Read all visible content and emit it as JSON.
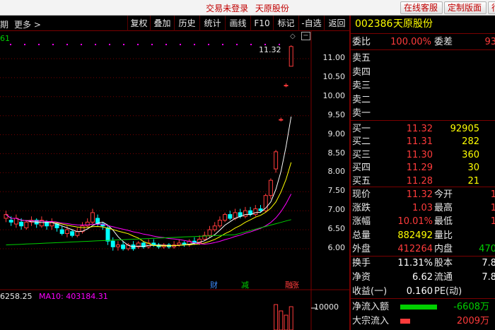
{
  "titlebar": {
    "trade_status": "交易未登录",
    "stock_name": "天原股份",
    "buttons": [
      "在线客服",
      "定制版面",
      "行"
    ]
  },
  "toolbar": {
    "period_label": "期",
    "more_label": "更多 >",
    "buttons": [
      "复权",
      "叠加",
      "历史",
      "统计",
      "画线",
      "F10",
      "标记",
      "-自选",
      "返回"
    ]
  },
  "chart": {
    "top_left_label": "61",
    "price_annotation": "11.32",
    "y_ticks": [
      "11.00",
      "10.50",
      "10.00",
      "9.50",
      "9.00",
      "8.50",
      "8.00",
      "7.50",
      "7.00",
      "6.50",
      "6.00"
    ],
    "events": [
      {
        "label": "财",
        "color": "#3c8cff"
      },
      {
        "label": "减",
        "color": "#00d000"
      },
      {
        "label": "融",
        "color": "#ff3b3b"
      },
      {
        "label": "涨",
        "color": "#ff3b3b"
      }
    ],
    "ma_vol5": "6258.25",
    "ma_vol10_label": "MA10: 403184.31",
    "vol_tick": "10000",
    "colors": {
      "up": "#ff3b3b",
      "down": "#00ffff",
      "ma5": "#ffffff",
      "ma10": "#ffff00",
      "ma20": "#ff00ff",
      "ma60": "#00d000"
    }
  },
  "panel": {
    "code": "002386",
    "name": "天原股份",
    "weibi_label": "委比",
    "weibi_value": "100.00%",
    "weicha_label": "委差",
    "weicha_value": "93",
    "sells": [
      {
        "label": "卖五"
      },
      {
        "label": "卖四"
      },
      {
        "label": "卖三"
      },
      {
        "label": "卖二"
      },
      {
        "label": "卖一"
      }
    ],
    "buys": [
      {
        "label": "买一",
        "price": "11.32",
        "vol": "92905"
      },
      {
        "label": "买二",
        "price": "11.31",
        "vol": "282"
      },
      {
        "label": "买三",
        "price": "11.30",
        "vol": "360"
      },
      {
        "label": "买四",
        "price": "11.29",
        "vol": "30"
      },
      {
        "label": "买五",
        "price": "11.28",
        "vol": "21"
      }
    ],
    "quote": [
      {
        "l1": "现价",
        "v1": "11.32",
        "l2": "今开",
        "v2": "1"
      },
      {
        "l1": "涨跌",
        "v1": "1.03",
        "l2": "最高",
        "v2": "1"
      },
      {
        "l1": "涨幅",
        "v1": "10.01%",
        "l2": "最低",
        "v2": "1"
      },
      {
        "l1": "总量",
        "v1": "882492",
        "l2": "量比",
        "v2": ""
      },
      {
        "l1": "外盘",
        "v1": "412264",
        "l2": "内盘",
        "v2": "470"
      }
    ],
    "info": [
      {
        "l1": "换手",
        "v1": "11.31%",
        "l2": "股本",
        "v2": "7.8"
      },
      {
        "l1": "净资",
        "v1": "6.62",
        "l2": "流通",
        "v2": "7.8"
      },
      {
        "l1": "收益(一)",
        "v1": "0.160",
        "l2": "PE(动)",
        "v2": ""
      }
    ],
    "flow": [
      {
        "label": "净流入额",
        "value": "-6608万"
      },
      {
        "label": "大宗流入",
        "value": "2009万"
      }
    ]
  }
}
